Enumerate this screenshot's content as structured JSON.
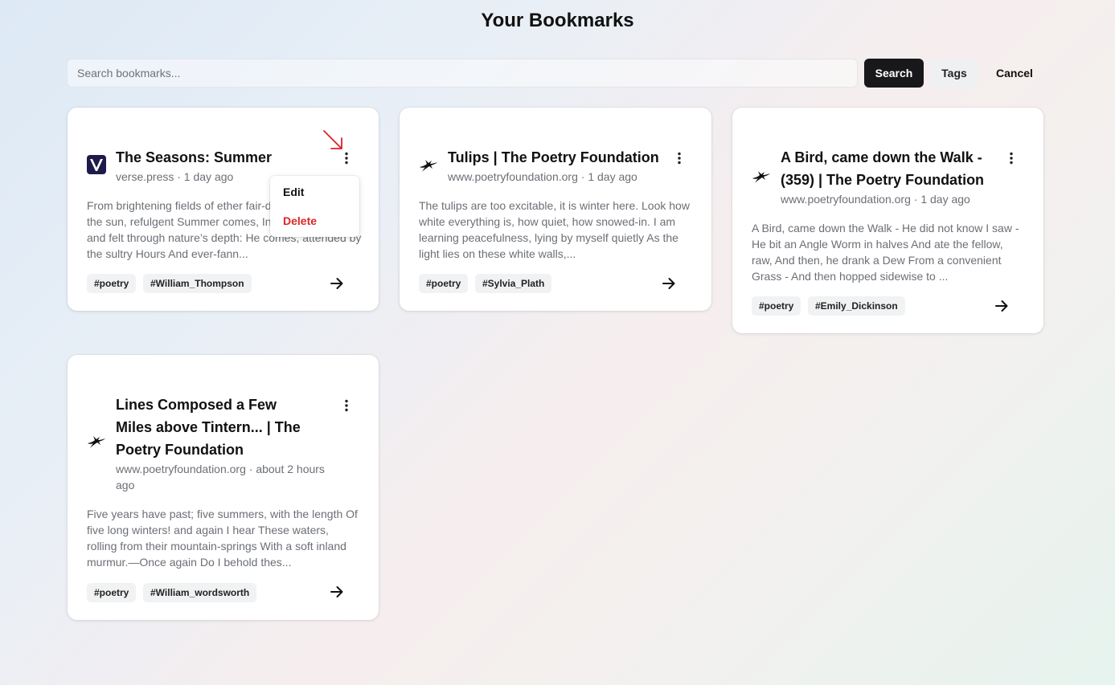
{
  "page": {
    "title": "Your Bookmarks"
  },
  "toolbar": {
    "search_placeholder": "Search bookmarks...",
    "search_label": "Search",
    "tags_label": "Tags",
    "cancel_label": "Cancel"
  },
  "bookmarks": [
    {
      "title": "The Seasons: Summer",
      "meta": "verse.press · 1 day ago",
      "description": "From brightening fields of ether fair-disclosed, child of the sun, refulgent Summer comes, In pride of youth, and felt through nature’s depth: He comes, attended by the sultry Hours And ever-fann...",
      "favicon": "verse-press-logo",
      "tags": [
        "#poetry",
        "#William_Thompson"
      ]
    },
    {
      "title": "Tulips | The Poetry Foundation",
      "meta": "www.poetryfoundation.org · 1 day ago",
      "description": "The tulips are too excitable, it is winter here. Look how white everything is, how quiet, how snowed-in. I am learning peacefulness, lying by myself quietly As the light lies on these white walls,...",
      "favicon": "poetry-foundation-bird",
      "tags": [
        "#poetry",
        "#Sylvia_Plath"
      ]
    },
    {
      "title": "A Bird, came down the Walk - (359) | The Poetry Foundation",
      "meta": "www.poetryfoundation.org · 1 day ago",
      "description": "A Bird, came down the Walk - He did not know I saw - He bit an Angle Worm in halves And ate the fellow, raw, And then, he drank a Dew From a convenient Grass - And then hopped sidewise to ...",
      "favicon": "poetry-foundation-bird",
      "tags": [
        "#poetry",
        "#Emily_Dickinson"
      ]
    },
    {
      "title": "Lines Composed a Few Miles above Tintern... | The Poetry Foundation",
      "meta": "www.poetryfoundation.org · about 2 hours ago",
      "description": "Five years have past; five summers, with the length Of five long winters! and again I hear These waters, rolling from their mountain-springs With a soft inland murmur.—Once again Do I behold thes...",
      "favicon": "poetry-foundation-bird",
      "tags": [
        "#poetry",
        "#William_wordsworth"
      ]
    }
  ],
  "context_menu": {
    "edit_label": "Edit",
    "delete_label": "Delete",
    "delete_color": "#dc2626"
  },
  "icons": {
    "more": "more-vertical-icon",
    "open": "arrow-right-icon",
    "annotation": "red-pointer-arrow"
  }
}
